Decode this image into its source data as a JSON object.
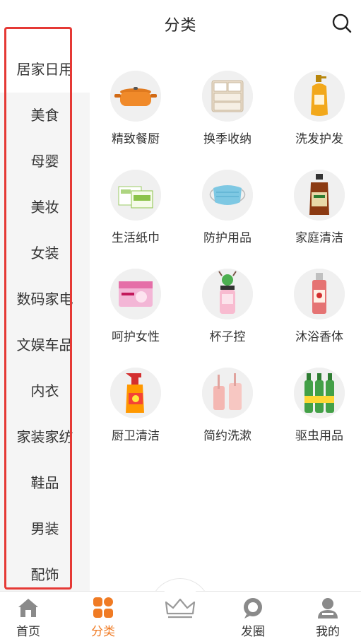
{
  "header": {
    "title": "分类"
  },
  "sidebar": {
    "items": [
      {
        "label": "居家日用"
      },
      {
        "label": "美食"
      },
      {
        "label": "母婴"
      },
      {
        "label": "美妆"
      },
      {
        "label": "女装"
      },
      {
        "label": "数码家电"
      },
      {
        "label": "文娱车品"
      },
      {
        "label": "内衣"
      },
      {
        "label": "家装家纺"
      },
      {
        "label": "鞋品"
      },
      {
        "label": "男装"
      },
      {
        "label": "配饰"
      }
    ]
  },
  "grid": {
    "items": [
      {
        "label": "精致餐厨",
        "icon": "cookware-pot-icon"
      },
      {
        "label": "换季收纳",
        "icon": "storage-drawer-icon"
      },
      {
        "label": "洗发护发",
        "icon": "shampoo-bottle-icon"
      },
      {
        "label": "生活纸巾",
        "icon": "tissue-pack-icon"
      },
      {
        "label": "防护用品",
        "icon": "face-mask-icon"
      },
      {
        "label": "家庭清洁",
        "icon": "disinfectant-bottle-icon"
      },
      {
        "label": "呵护女性",
        "icon": "sanitary-pad-icon"
      },
      {
        "label": "杯子控",
        "icon": "water-bottle-icon"
      },
      {
        "label": "沐浴香体",
        "icon": "body-mist-icon"
      },
      {
        "label": "厨卫清洁",
        "icon": "spray-cleaner-icon"
      },
      {
        "label": "简约洗漱",
        "icon": "toothbrush-cup-icon"
      },
      {
        "label": "驱虫用品",
        "icon": "insect-repellent-icon"
      }
    ]
  },
  "tabbar": {
    "items": [
      {
        "label": "首页",
        "icon": "home-icon"
      },
      {
        "label": "分类",
        "icon": "category-icon"
      },
      {
        "label": "",
        "icon": "crown-icon"
      },
      {
        "label": "发圈",
        "icon": "chat-bubble-icon"
      },
      {
        "label": "我的",
        "icon": "user-icon"
      }
    ]
  },
  "colors": {
    "accent": "#f07b24",
    "highlight": "#e53935",
    "sidebar_bg": "#f5f5f5"
  }
}
